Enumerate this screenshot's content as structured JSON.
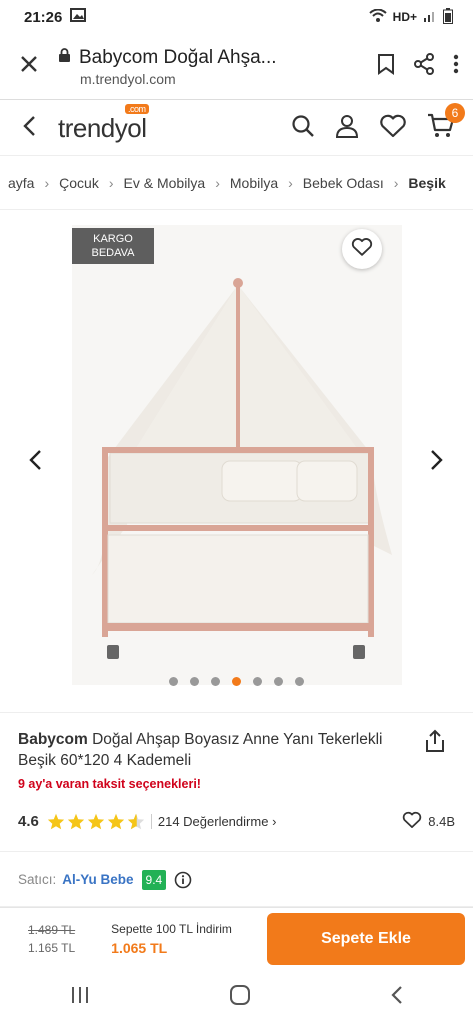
{
  "status_bar": {
    "time": "21:26",
    "network": "HD+"
  },
  "browser": {
    "page_title": "Babycom Doğal Ahşa...",
    "url": "m.trendyol.com"
  },
  "site": {
    "logo_text": "trendyol",
    "logo_badge": ".com",
    "cart_count": "6"
  },
  "breadcrumb": {
    "items": [
      "ayfa",
      "Çocuk",
      "Ev & Mobilya",
      "Mobilya",
      "Bebek Odası",
      "Beşik"
    ],
    "separator": "›"
  },
  "gallery": {
    "badge_line1": "KARGO",
    "badge_line2": "BEDAVA",
    "image_count": 7,
    "active_index": 3
  },
  "product": {
    "brand": "Babycom",
    "name": "Doğal Ahşap Boyasız Anne Yanı Tekerlekli Beşik 60*120 4 Kademeli",
    "installment": "9 ay'a varan taksit seçenekleri!",
    "rating": "4.6",
    "rating_value": 4.6,
    "reviews": "214  Değerlendirme",
    "reviews_chevron": "›",
    "likes": "8.4B"
  },
  "seller": {
    "label": "Satıcı:",
    "name": "Al-Yu Bebe",
    "score": "9.4"
  },
  "buy_bar": {
    "old_price": "1.489 TL",
    "price": "1.165 TL",
    "cart_discount": "Sepette 100 TL İndirim",
    "final_price": "1.065 TL",
    "add_to_cart": "Sepete Ekle"
  },
  "colors": {
    "brand_orange": "#f27a1a",
    "installment_red": "#d0021b",
    "seller_blue": "#3a74c4",
    "score_green": "#22b155",
    "star_yellow": "#f5c518"
  }
}
